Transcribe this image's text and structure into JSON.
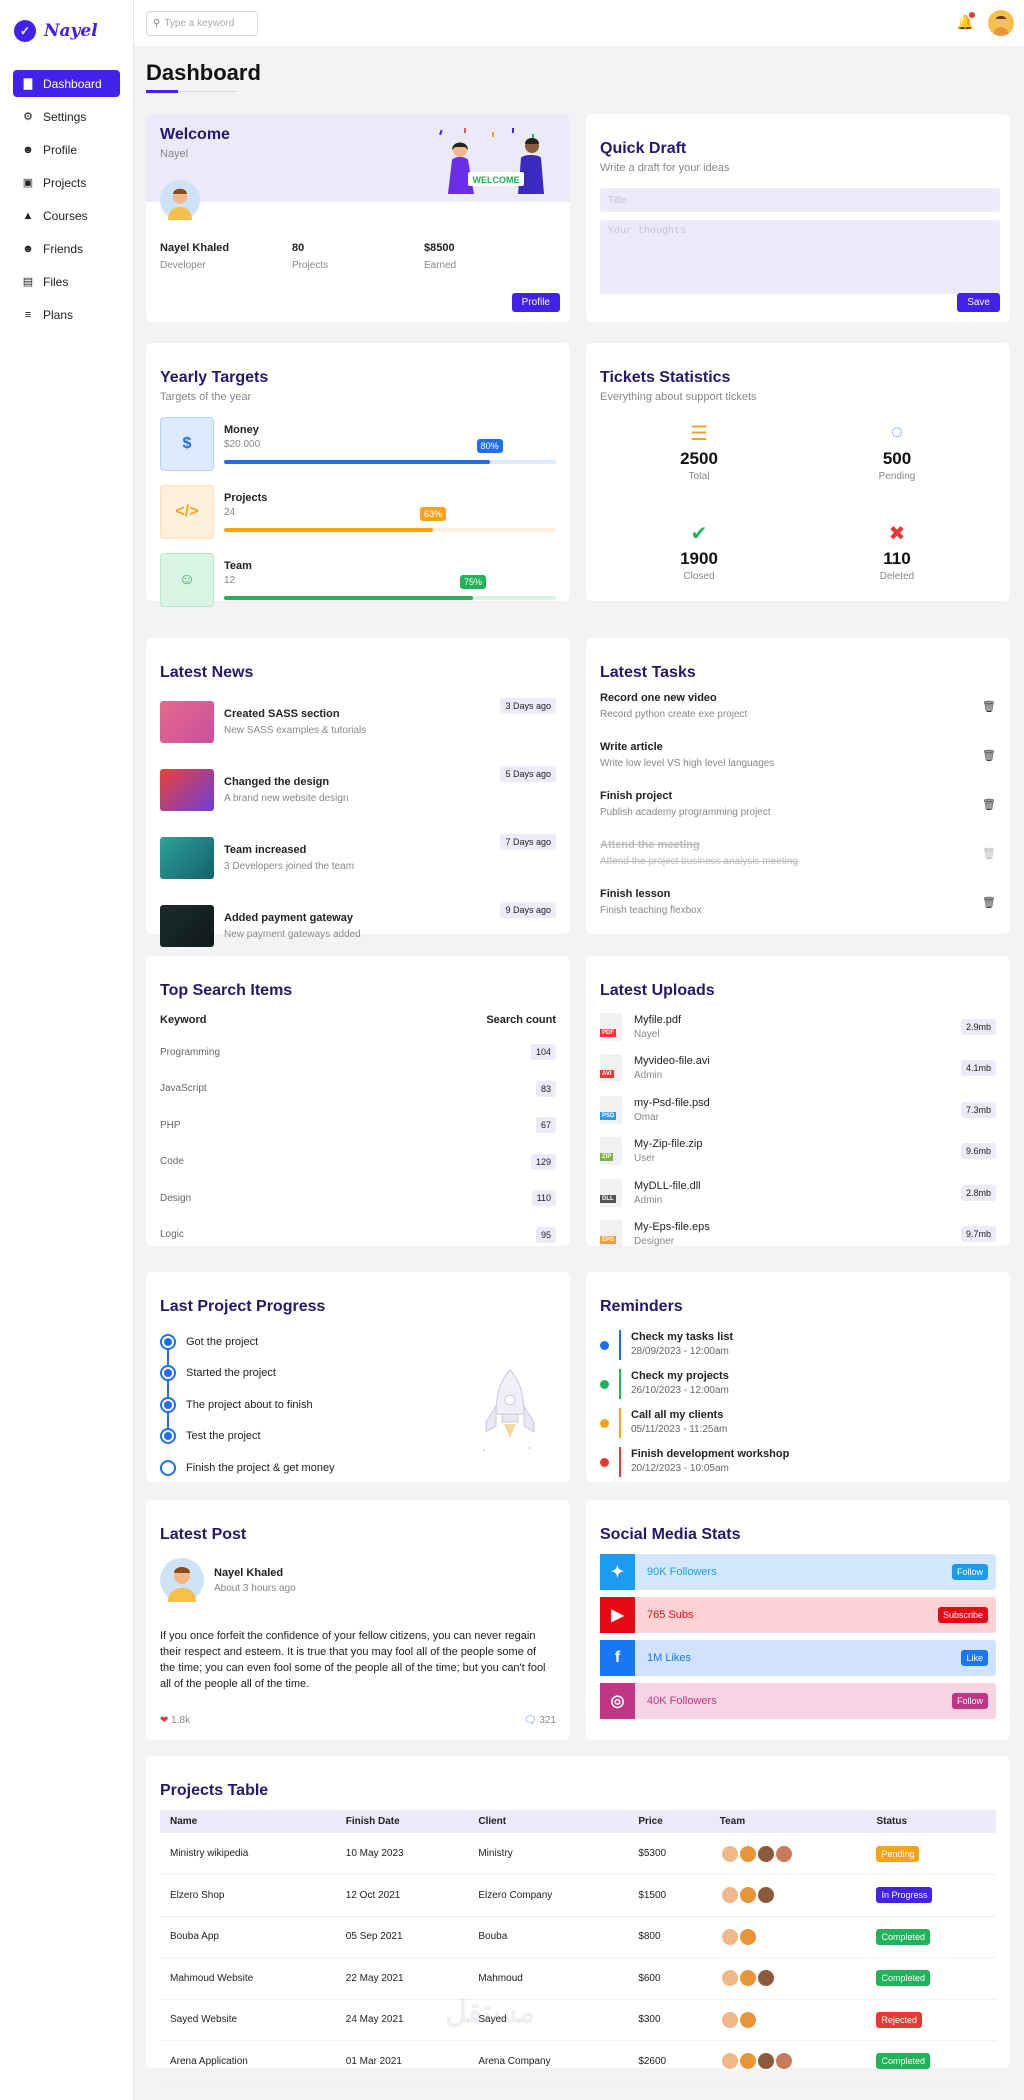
{
  "brand": {
    "name": "Nayel"
  },
  "sidebar": {
    "items": [
      {
        "label": "Dashboard",
        "icon": "chart-bar-icon"
      },
      {
        "label": "Settings",
        "icon": "gear-icon"
      },
      {
        "label": "Profile",
        "icon": "user-icon"
      },
      {
        "label": "Projects",
        "icon": "briefcase-icon"
      },
      {
        "label": "Courses",
        "icon": "graduation-cap-icon"
      },
      {
        "label": "Friends",
        "icon": "users-icon"
      },
      {
        "label": "Files",
        "icon": "file-icon"
      },
      {
        "label": "Plans",
        "icon": "layers-icon"
      }
    ]
  },
  "topbar": {
    "search_placeholder": "Type a keyword"
  },
  "page": {
    "title": "Dashboard"
  },
  "welcome": {
    "title": "Welcome",
    "subtitle": "Nayel",
    "illustration_text": "WELCOME",
    "stats": [
      {
        "value": "Nayel Khaled",
        "label": "Developer"
      },
      {
        "value": "80",
        "label": "Projects"
      },
      {
        "value": "$8500",
        "label": "Earned"
      }
    ],
    "button": "Profile"
  },
  "draft": {
    "title": "Quick Draft",
    "subtitle": "Write a draft for your ideas",
    "title_placeholder": "Title",
    "body_placeholder": "Your thoughts",
    "button": "Save"
  },
  "targets": {
    "title": "Yearly Targets",
    "subtitle": "Targets of the year",
    "items": [
      {
        "name": "Money",
        "value": "$20.000",
        "percent_label": "80%",
        "percent": 0.8,
        "color": "#1e6ff0",
        "bg": "#dcebff",
        "icon": "$"
      },
      {
        "name": "Projects",
        "value": "24",
        "percent_label": "63%",
        "percent": 0.63,
        "color": "#f5a31a",
        "bg": "#fff0db",
        "icon": "</>"
      },
      {
        "name": "Team",
        "value": "12",
        "percent_label": "75%",
        "percent": 0.75,
        "color": "#22b25a",
        "bg": "#daf5e3",
        "icon": "☺"
      }
    ]
  },
  "tickets": {
    "title": "Tickets Statistics",
    "subtitle": "Everything about support tickets",
    "items": [
      {
        "value": "2500",
        "label": "Total",
        "icon": "☰",
        "color": "#f5a31a"
      },
      {
        "value": "500",
        "label": "Pending",
        "icon": "◌",
        "color": "#1e6ff0"
      },
      {
        "value": "1900",
        "label": "Closed",
        "icon": "✔",
        "color": "#22b25a"
      },
      {
        "value": "110",
        "label": "Deleted",
        "icon": "✖",
        "color": "#e53935"
      }
    ]
  },
  "news": {
    "title": "Latest News",
    "items": [
      {
        "title": "Created SASS section",
        "desc": "New SASS examples & tutorials",
        "badge": "3 Days ago",
        "img": "linear-gradient(135deg,#e66a8a,#c94fa0)"
      },
      {
        "title": "Changed the design",
        "desc": "A brand new website design",
        "badge": "5 Days ago",
        "img": "linear-gradient(135deg,#e8423a,#6b3fd9)"
      },
      {
        "title": "Team increased",
        "desc": "3 Developers joined the team",
        "badge": "7 Days ago",
        "img": "linear-gradient(135deg,#2aa39a,#155f6b)"
      },
      {
        "title": "Added payment gateway",
        "desc": "New payment gateways added",
        "badge": "9 Days ago",
        "img": "linear-gradient(135deg,#1b2b2a,#0f1a1a)"
      }
    ]
  },
  "tasks": {
    "title": "Latest Tasks",
    "items": [
      {
        "title": "Record one new video",
        "desc": "Record python create exe project",
        "done": false
      },
      {
        "title": "Write article",
        "desc": "Write low level VS high level languages",
        "done": false
      },
      {
        "title": "Finish project",
        "desc": "Publish academy programming project",
        "done": false
      },
      {
        "title": "Attend the meeting",
        "desc": "Attend the project business analysis meeting",
        "done": true
      },
      {
        "title": "Finish lesson",
        "desc": "Finish teaching flexbox",
        "done": false
      }
    ]
  },
  "search_items": {
    "title": "Top Search Items",
    "col_keyword": "Keyword",
    "col_count": "Search count",
    "rows": [
      {
        "keyword": "Programming",
        "count": "104"
      },
      {
        "keyword": "JavaScript",
        "count": "83"
      },
      {
        "keyword": "PHP",
        "count": "67"
      },
      {
        "keyword": "Code",
        "count": "129"
      },
      {
        "keyword": "Design",
        "count": "110"
      },
      {
        "keyword": "Logic",
        "count": "95"
      }
    ]
  },
  "uploads": {
    "title": "Latest Uploads",
    "items": [
      {
        "name": "Myfile.pdf",
        "owner": "Nayel",
        "size": "2.9mb",
        "type": "PDF",
        "color": "#e53935"
      },
      {
        "name": "Myvideo-file.avi",
        "owner": "Admin",
        "size": "4.1mb",
        "type": "AVI",
        "color": "#e53935"
      },
      {
        "name": "my-Psd-file.psd",
        "owner": "Omar",
        "size": "7.3mb",
        "type": "PSD",
        "color": "#2e9be6"
      },
      {
        "name": "My-Zip-file.zip",
        "owner": "User",
        "size": "9.6mb",
        "type": "ZIP",
        "color": "#7cb342"
      },
      {
        "name": "MyDLL-file.dll",
        "owner": "Admin",
        "size": "2.8mb",
        "type": "DLL",
        "color": "#555"
      },
      {
        "name": "My-Eps-file.eps",
        "owner": "Designer",
        "size": "9.7mb",
        "type": "EPS",
        "color": "#f5a31a"
      }
    ]
  },
  "progress": {
    "title": "Last Project Progress",
    "steps": [
      {
        "label": "Got the project",
        "done": true
      },
      {
        "label": "Started the project",
        "done": true
      },
      {
        "label": "The project about to finish",
        "done": true
      },
      {
        "label": "Test the project",
        "done": true
      },
      {
        "label": "Finish the project & get money",
        "done": false
      }
    ]
  },
  "reminders": {
    "title": "Reminders",
    "items": [
      {
        "title": "Check my tasks list",
        "date": "28/09/2023 - 12:00am",
        "color": "#1e6ff0"
      },
      {
        "title": "Check my projects",
        "date": "26/10/2023 - 12:00am",
        "color": "#22b25a"
      },
      {
        "title": "Call all my clients",
        "date": "05/11/2023 - 11:25am",
        "color": "#f5a31a"
      },
      {
        "title": "Finish development workshop",
        "date": "20/12/2023 - 10:05am",
        "color": "#e53935"
      }
    ]
  },
  "post": {
    "title": "Latest Post",
    "author": "Nayel Khaled",
    "time": "About 3 hours ago",
    "text": "If you once forfeit the confidence of your fellow citizens, you can never regain their respect and esteem. It is true that you may fool all of the people some of the time; you can even fool some of the people all of the time; but you can't fool all of the people all of the time.",
    "likes": "1.8k",
    "comments": "321"
  },
  "social": {
    "title": "Social Media Stats",
    "items": [
      {
        "text": "90K Followers",
        "button": "Follow",
        "color": "#1d9bf0",
        "bg": "#d3e9fb",
        "icon": "✦"
      },
      {
        "text": "765 Subs",
        "button": "Subscribe",
        "color": "#e50914",
        "bg": "#fbd3d4",
        "icon": "▶"
      },
      {
        "text": "1M Likes",
        "button": "Like",
        "color": "#1877f2",
        "bg": "#d1e3fc",
        "icon": "f"
      },
      {
        "text": "40K Followers",
        "button": "Follow",
        "color": "#c13584",
        "bg": "#f5d5e4",
        "icon": "◎"
      }
    ]
  },
  "projects": {
    "title": "Projects Table",
    "columns": [
      "Name",
      "Finish Date",
      "Client",
      "Price",
      "Team",
      "Status"
    ],
    "rows": [
      {
        "name": "Ministry wikipedia",
        "date": "10 May 2023",
        "client": "Ministry",
        "price": "$5300",
        "team": 4,
        "status": "Pending",
        "color": "#f5a31a"
      },
      {
        "name": "Elzero Shop",
        "date": "12 Oct 2021",
        "client": "Elzero Company",
        "price": "$1500",
        "team": 3,
        "status": "In Progress",
        "color": "#4221e8"
      },
      {
        "name": "Bouba App",
        "date": "05 Sep 2021",
        "client": "Bouba",
        "price": "$800",
        "team": 2,
        "status": "Completed",
        "color": "#22b25a"
      },
      {
        "name": "Mahmoud Website",
        "date": "22 May 2021",
        "client": "Mahmoud",
        "price": "$600",
        "team": 3,
        "status": "Completed",
        "color": "#22b25a"
      },
      {
        "name": "Sayed Website",
        "date": "24 May 2021",
        "client": "Sayed",
        "price": "$300",
        "team": 2,
        "status": "Rejected",
        "color": "#e53935"
      },
      {
        "name": "Arena Application",
        "date": "01 Mar 2021",
        "client": "Arena Company",
        "price": "$2600",
        "team": 4,
        "status": "Completed",
        "color": "#22b25a"
      }
    ]
  }
}
